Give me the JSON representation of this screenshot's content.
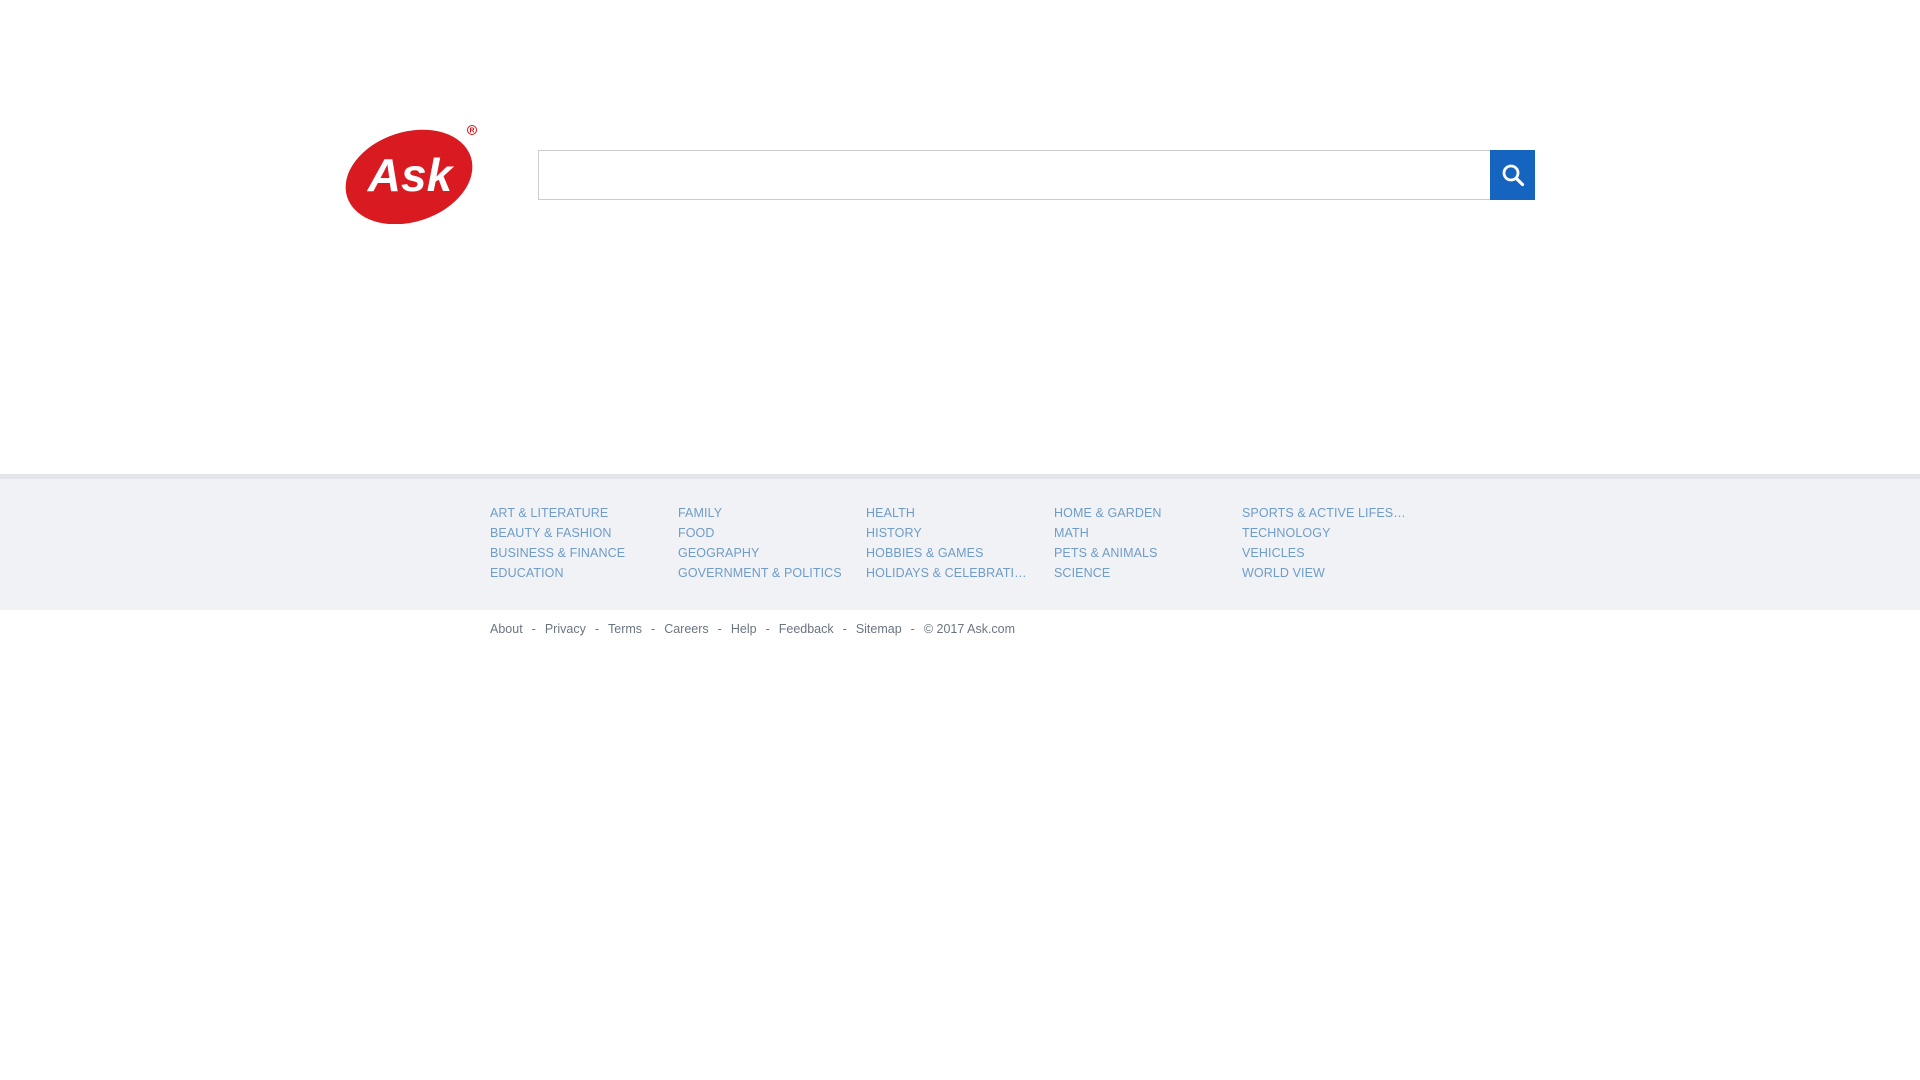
{
  "brand": {
    "logo_text": "Ask",
    "registered_mark": "®",
    "logo_color": "#d91a21"
  },
  "search": {
    "value": "",
    "placeholder": "",
    "button_icon": "search-icon",
    "button_color": "#1565c0"
  },
  "categories": {
    "columns": [
      [
        "ART & LITERATURE",
        "BEAUTY & FASHION",
        "BUSINESS & FINANCE",
        "EDUCATION"
      ],
      [
        "FAMILY",
        "FOOD",
        "GEOGRAPHY",
        "GOVERNMENT & POLITICS"
      ],
      [
        "HEALTH",
        "HISTORY",
        "HOBBIES & GAMES",
        "HOLIDAYS & CELEBRATIONS"
      ],
      [
        "HOME & GARDEN",
        "MATH",
        "PETS & ANIMALS",
        "SCIENCE"
      ],
      [
        "SPORTS & ACTIVE LIFESTYLE",
        "TECHNOLOGY",
        "VEHICLES",
        "WORLD VIEW"
      ]
    ],
    "link_color": "#6f9cc9",
    "band_color": "#f0f2f5"
  },
  "footer": {
    "links": [
      "About",
      "Privacy",
      "Terms",
      "Careers",
      "Help",
      "Feedback",
      "Sitemap"
    ],
    "separator": "-",
    "copyright": "© 2017 Ask.com"
  }
}
